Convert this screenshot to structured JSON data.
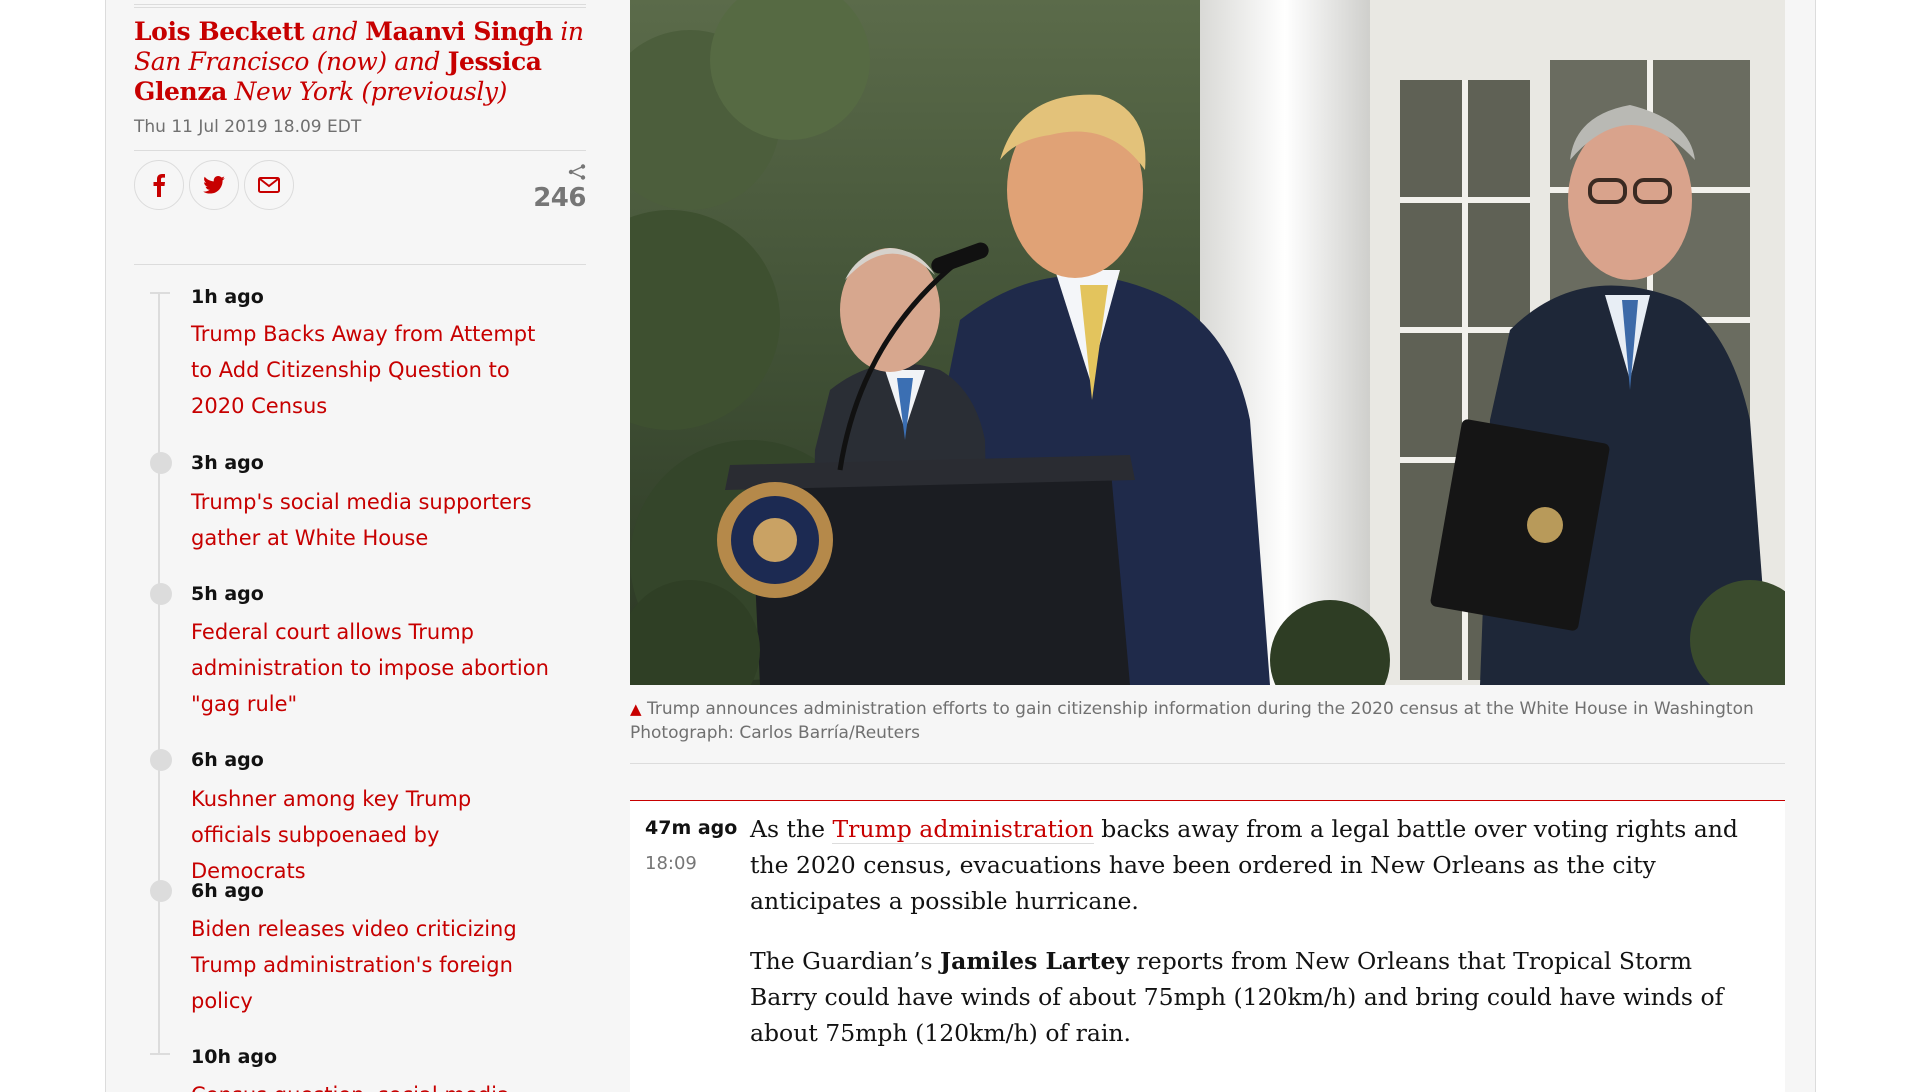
{
  "byline": {
    "author1": "Lois Beckett",
    "and1": "and",
    "author2": "Maanvi Singh",
    "loc1": "in San Francisco (now)",
    "and2": "and",
    "author3": "Jessica Glenza",
    "loc2": "New York (previously)"
  },
  "dateline": "Thu 11 Jul 2019 18.09 EDT",
  "share": {
    "facebook_icon": "facebook-icon",
    "twitter_icon": "twitter-icon",
    "email_icon": "email-icon",
    "count": "246"
  },
  "key_events": [
    {
      "time": "1h ago",
      "title": "Trump Backs Away from Attempt to Add Citizenship Question to 2020 Census"
    },
    {
      "time": "3h ago",
      "title": "Trump's social media supporters gather at White House"
    },
    {
      "time": "5h ago",
      "title": "Federal court allows Trump administration to impose abortion \"gag rule\""
    },
    {
      "time": "6h ago",
      "title": "Kushner among key Trump officials subpoenaed by Democrats"
    },
    {
      "time": "6h ago",
      "title": "Biden releases video criticizing Trump administration's foreign policy"
    },
    {
      "time": "10h ago",
      "title": "Census question, social media"
    }
  ],
  "photo": {
    "caption": "Trump announces administration efforts to gain citizenship information during the 2020 census at the White House in Washington",
    "credit": "Photograph: Carlos Barría/Reuters"
  },
  "post": {
    "relative_time": "47m ago",
    "clock_time": "18:09",
    "p1_before": "As the ",
    "p1_link": "Trump administration",
    "p1_after": " backs away from a legal battle over voting rights and the 2020 census, evacuations have been ordered in New Orleans as the city anticipates a possible hurricane.",
    "p2_before": "The Guardian’s ",
    "p2_name": "Jamiles Lartey",
    "p2_after": " reports from New Orleans that Tropical Storm Barry could have winds of about 75mph (120km/h) and bring could have winds of about 75mph (120km/h) of rain."
  },
  "colors": {
    "accent": "#c70000",
    "background": "#f6f6f6",
    "rule": "#dcdcdc"
  }
}
